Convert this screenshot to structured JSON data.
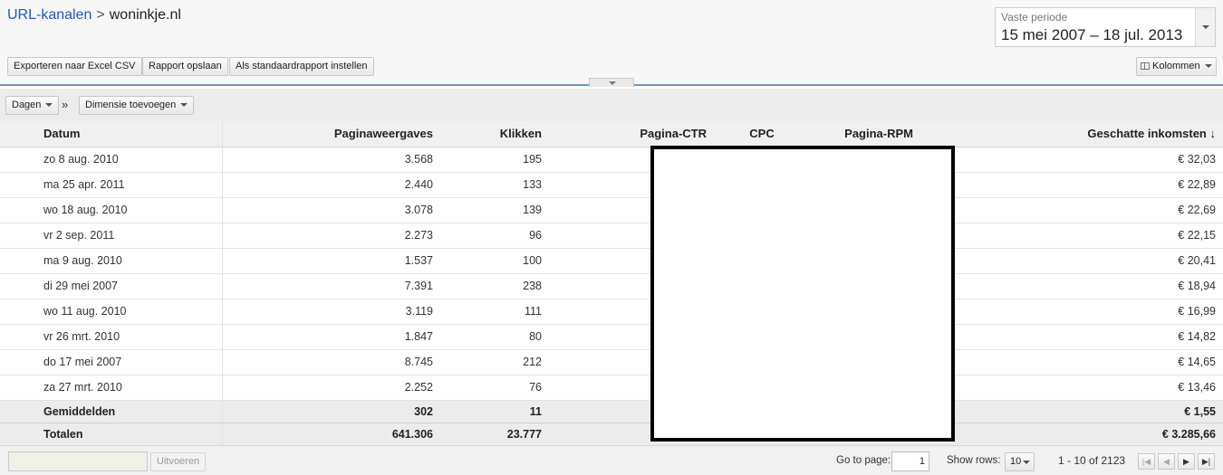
{
  "breadcrumb": {
    "parent": "URL-kanalen",
    "separator": ">",
    "current": "woninkje.nl"
  },
  "period": {
    "label": "Vaste periode",
    "value": "15 mei 2007 – 18 jul. 2013"
  },
  "toolbar": {
    "export_label": "Exporteren naar Excel CSV",
    "save_label": "Rapport opslaan",
    "default_label": "Als standaardrapport instellen",
    "columns_label": "Kolommen"
  },
  "toolbar2": {
    "days_label": "Dagen",
    "separator": "»",
    "add_dimension_label": "Dimensie toevoegen"
  },
  "table": {
    "headers": [
      "Datum",
      "Paginaweergaves",
      "Klikken",
      "Pagina-CTR",
      "CPC",
      "Pagina-RPM",
      "Geschatte inkomsten ↓"
    ],
    "rows": [
      [
        "zo 8 aug. 2010",
        "3.568",
        "195",
        "€ 32,03"
      ],
      [
        "ma 25 apr. 2011",
        "2.440",
        "133",
        "€ 22,89"
      ],
      [
        "wo 18 aug. 2010",
        "3.078",
        "139",
        "€ 22,69"
      ],
      [
        "vr 2 sep. 2011",
        "2.273",
        "96",
        "€ 22,15"
      ],
      [
        "ma 9 aug. 2010",
        "1.537",
        "100",
        "€ 20,41"
      ],
      [
        "di 29 mei 2007",
        "7.391",
        "238",
        "€ 18,94"
      ],
      [
        "wo 11 aug. 2010",
        "3.119",
        "111",
        "€ 16,99"
      ],
      [
        "vr 26 mrt. 2010",
        "1.847",
        "80",
        "€ 14,82"
      ],
      [
        "do 17 mei 2007",
        "8.745",
        "212",
        "€ 14,65"
      ],
      [
        "za 27 mrt. 2010",
        "2.252",
        "76",
        "€ 13,46"
      ]
    ],
    "averages": [
      "Gemiddelden",
      "302",
      "11",
      "€ 1,55"
    ],
    "totals": [
      "Totalen",
      "641.306",
      "23.777",
      "€ 3.285,66"
    ]
  },
  "footer": {
    "run_label": "Uitvoeren",
    "goto_label": "Go to page:",
    "page_value": "1",
    "show_rows_label": "Show rows:",
    "rows_value": "10",
    "range": "1 - 10 of 2123"
  }
}
